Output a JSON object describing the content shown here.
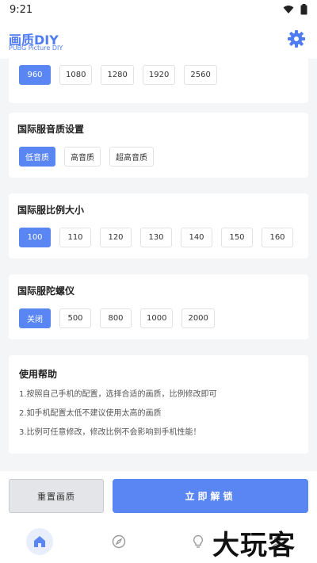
{
  "status_bar": {
    "time": "9:21"
  },
  "header": {
    "title": "画质DIY",
    "subtitle": "PUBG Picture DIY"
  },
  "resolution": {
    "options": [
      "960",
      "1080",
      "1280",
      "1920",
      "2560"
    ],
    "selected": 0
  },
  "audio": {
    "title": "国际服音质设置",
    "options": [
      "低音质",
      "高音质",
      "超高音质"
    ],
    "selected": 0
  },
  "scale": {
    "title": "国际服比例大小",
    "options": [
      "100",
      "110",
      "120",
      "130",
      "140",
      "150",
      "160"
    ],
    "selected": 0
  },
  "gyro": {
    "title": "国际服陀螺仪",
    "options": [
      "关闭",
      "500",
      "800",
      "1000",
      "2000"
    ],
    "selected": 0
  },
  "help": {
    "title": "使用帮助",
    "lines": [
      "1.按照自己手机的配置，选择合适的画质，比例修改即可",
      "2.如手机配置太低不建议使用太高的画质",
      "3.比例可任意修改，修改比例不会影响到手机性能！"
    ]
  },
  "actions": {
    "reset_label": "重置画质",
    "unlock_label": "立即解锁"
  },
  "watermark": {
    "text": "大玩客"
  },
  "colors": {
    "accent": "#5a86f4",
    "title_blue": "#4f7cf2"
  }
}
